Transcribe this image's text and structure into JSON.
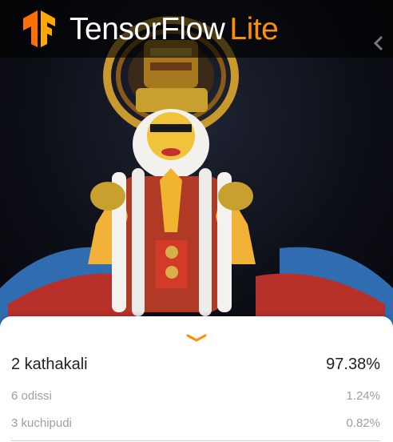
{
  "app_bar": {
    "brand_main": "TensorFlow",
    "brand_sub": "Lite",
    "logo_icon": "tensorflow-logo-icon",
    "accent_color": "#ff8f00"
  },
  "results": {
    "top": {
      "label": "2 kathakali",
      "score": "97.38%"
    },
    "items": [
      {
        "label": "6 odissi",
        "score": "1.24%"
      },
      {
        "label": "3 kuchipudi",
        "score": "0.82%"
      }
    ]
  },
  "sheet": {
    "handle_icon": "chevron-down-icon"
  }
}
